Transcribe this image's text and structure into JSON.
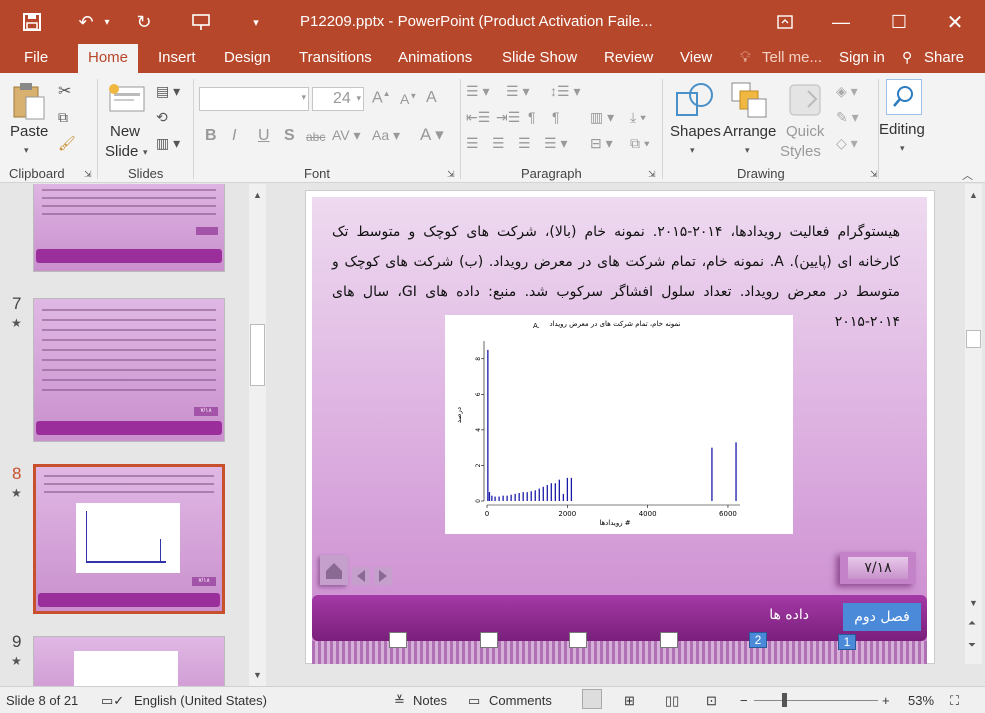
{
  "window": {
    "title": "P12209.pptx - PowerPoint (Product Activation Faile..."
  },
  "qat": {
    "save": "save-icon",
    "undo": "undo-icon",
    "redo": "redo-icon"
  },
  "tabs": [
    "File",
    "Home",
    "Insert",
    "Design",
    "Transitions",
    "Animations",
    "Slide Show",
    "Review",
    "View"
  ],
  "tell_me": "Tell me...",
  "sign_in": "Sign in",
  "share": "Share",
  "ribbon": {
    "clipboard": {
      "label": "Clipboard",
      "paste": "Paste"
    },
    "slides": {
      "label": "Slides",
      "new_slide_1": "New",
      "new_slide_2": "Slide"
    },
    "font": {
      "label": "Font",
      "size": "24",
      "font_name": ""
    },
    "paragraph": {
      "label": "Paragraph"
    },
    "drawing": {
      "label": "Drawing",
      "shapes": "Shapes",
      "arrange": "Arrange",
      "quick_1": "Quick",
      "quick_2": "Styles"
    },
    "editing": {
      "label": "Editing"
    }
  },
  "thumbnails": [
    {
      "num": "7",
      "page": "۷/۱۸"
    },
    {
      "num": "8",
      "page": "۷/۱۸"
    },
    {
      "num": "9",
      "page": ""
    }
  ],
  "slide": {
    "body_text": "هیستوگرام فعالیت رویدادها، ۲۰۱۴-۲۰۱۵. نمونه خام (بالا)، شرکت های کوچک و متوسط تک کارخانه ای (پایین). A. نمونه خام، تمام شرکت های در معرض رویداد. (ب) شرکت های کوچک و متوسط در معرض رویداد. تعداد سلول افشاگر سرکوب شد. منبع: داده های GI، سال های ۲۰۱۴-۲۰۱۵",
    "page_number": "۷/۱۸",
    "chapter": "فصل دوم",
    "section": "داده ها",
    "nav_nums": [
      "2",
      "1"
    ]
  },
  "chart_data": {
    "type": "bar",
    "title": "نمونه خام، تمام شرکت های در معرض رویداد",
    "panel_label": "A.",
    "xlabel": "# رویدادها",
    "ylabel": "درصد",
    "xlim": [
      0,
      6300
    ],
    "ylim": [
      0,
      9
    ],
    "xticks": [
      "0",
      "2000",
      "4000",
      "6000"
    ],
    "yticks": [
      "0",
      "2",
      "4",
      "6",
      "8"
    ],
    "x": [
      20,
      60,
      120,
      200,
      300,
      400,
      500,
      600,
      700,
      800,
      900,
      1000,
      1100,
      1200,
      1300,
      1400,
      1500,
      1600,
      1700,
      1800,
      1900,
      2000,
      2100,
      5600,
      6200
    ],
    "values": [
      8.5,
      0.5,
      0.3,
      0.25,
      0.25,
      0.3,
      0.3,
      0.35,
      0.4,
      0.45,
      0.5,
      0.5,
      0.55,
      0.6,
      0.7,
      0.8,
      0.9,
      1.0,
      1.0,
      1.2,
      0.4,
      1.3,
      1.3,
      3.0,
      3.3
    ],
    "grid": false
  },
  "status": {
    "slide_of": "Slide 8 of 21",
    "language": "English (United States)",
    "notes": "Notes",
    "comments": "Comments",
    "zoom": "53%"
  }
}
